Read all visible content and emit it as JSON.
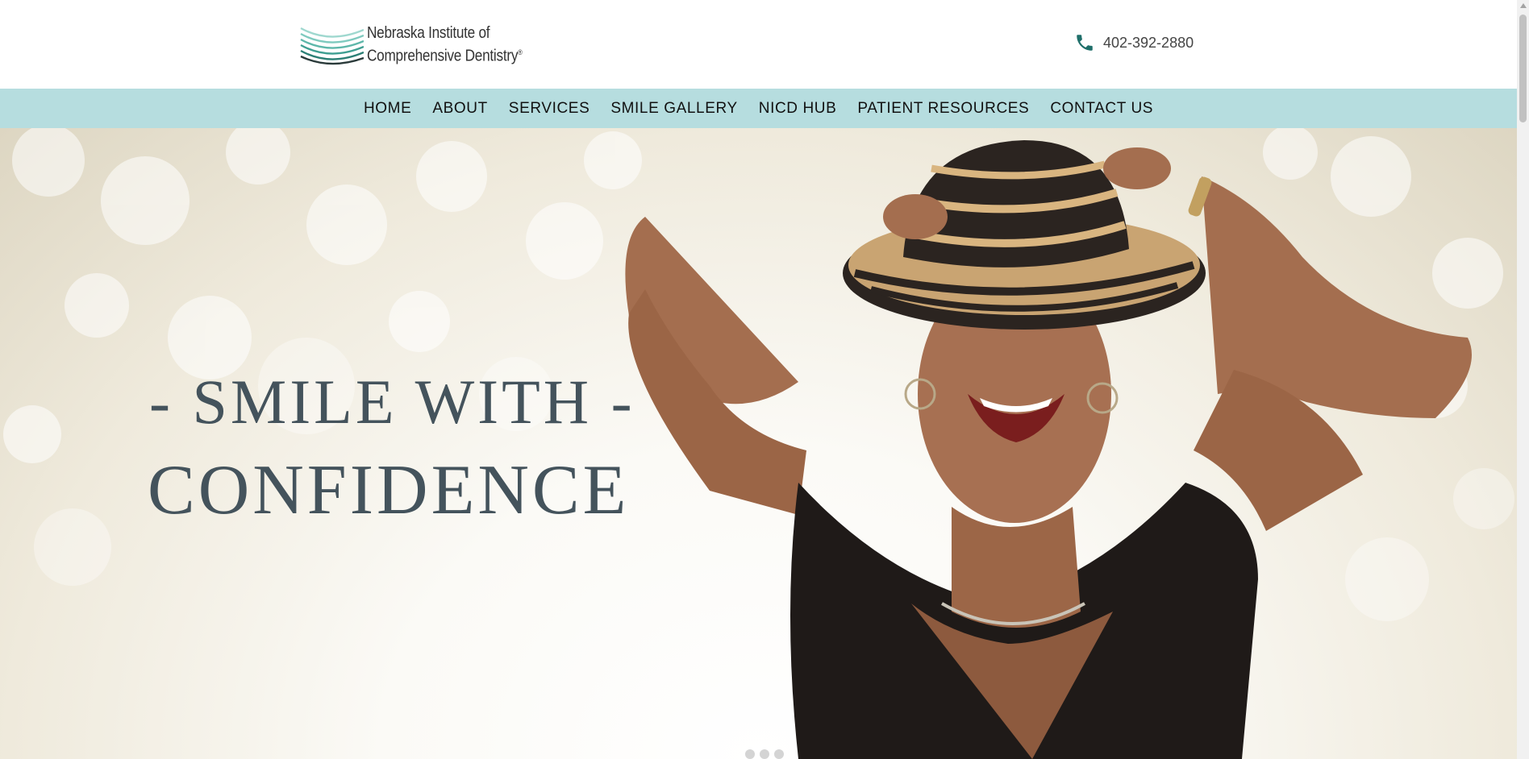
{
  "header": {
    "logo_line1": "Nebraska Institute of",
    "logo_line2": "Comprehensive Dentistry",
    "logo_reg": "®",
    "phone": "402-392-2880"
  },
  "nav": {
    "items": [
      "HOME",
      "ABOUT",
      "SERVICES",
      "SMILE GALLERY",
      "NICD HUB",
      "PATIENT RESOURCES",
      "CONTACT US"
    ]
  },
  "hero": {
    "line1": "- SMILE WITH -",
    "line2": "CONFIDENCE",
    "slide_dots": 3
  },
  "colors": {
    "nav_bg": "#b6dddf",
    "headline": "#44535c",
    "logo_teal": "#2e9a8e"
  },
  "icons": [
    "phone-icon",
    "logo-mark"
  ]
}
